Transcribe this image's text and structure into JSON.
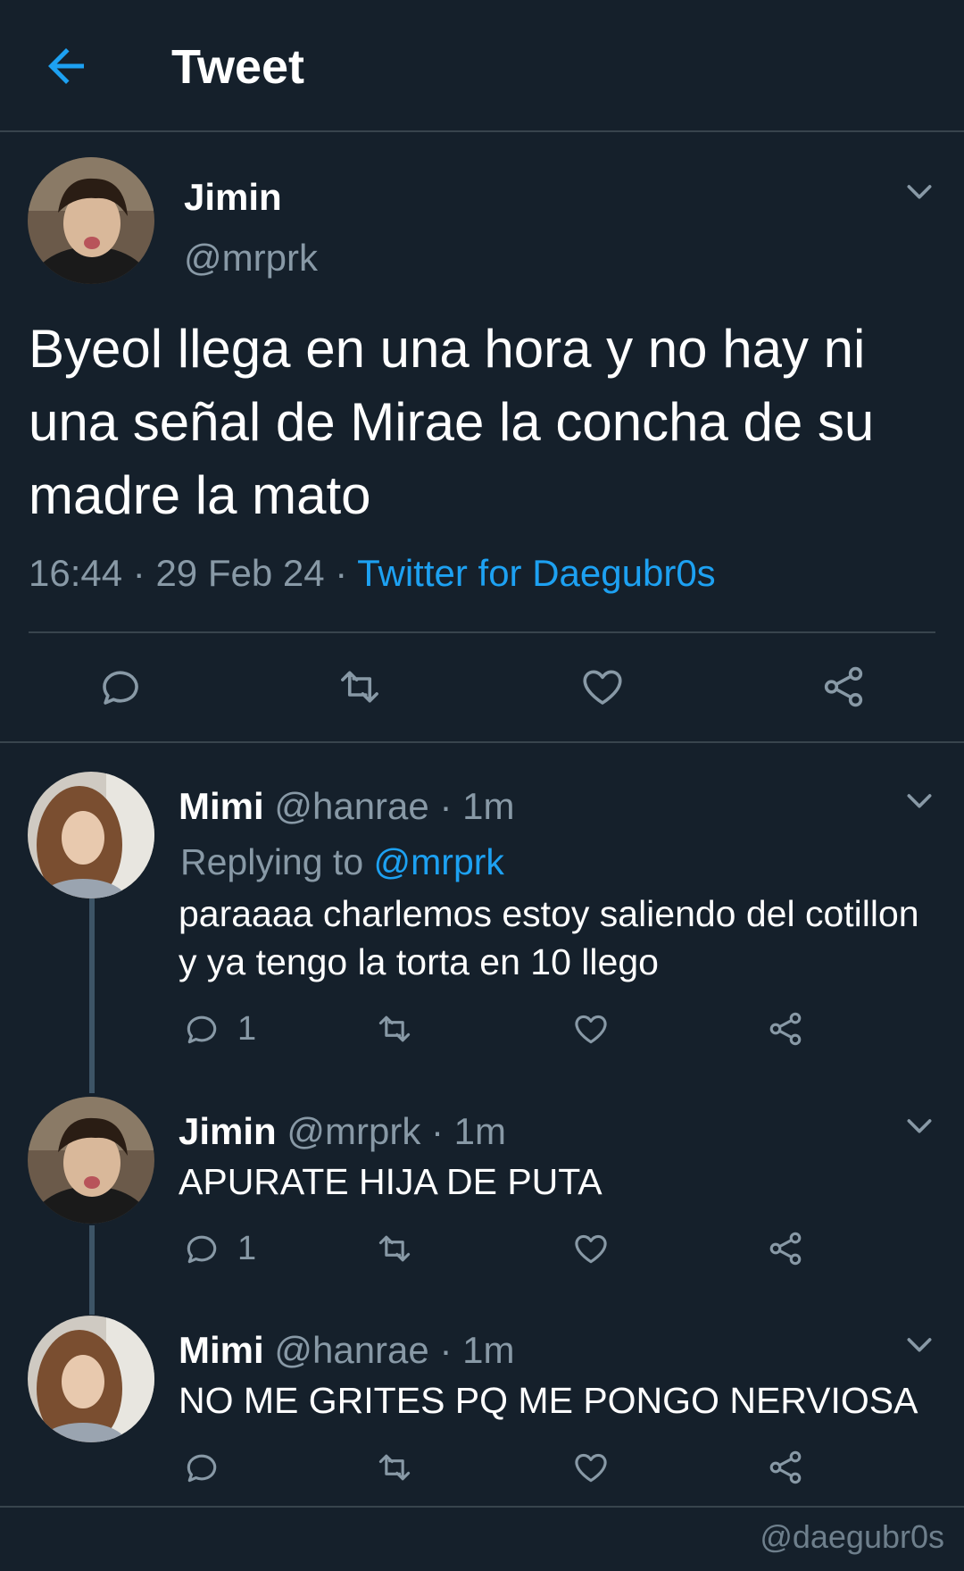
{
  "header": {
    "title": "Tweet"
  },
  "main_tweet": {
    "name": "Jimin",
    "handle": "@mrprk",
    "text": "Byeol llega en una hora y no hay ni una señal de Mirae la concha de su madre la mato",
    "time": "16:44",
    "sep1": " · ",
    "date": "29 Feb 24",
    "sep2": " · ",
    "source": "Twitter for Daegubr0s"
  },
  "replies": [
    {
      "name": "Mimi",
      "handle": "@hanrae",
      "time": "· 1m",
      "replying_label": "Replying to",
      "replying_to": "@mrprk",
      "text": "paraaaa charlemos estoy saliendo del cotillon y ya tengo la torta en 10 llego",
      "reply_count": "1"
    },
    {
      "name": "Jimin",
      "handle": "@mrprk",
      "time": "· 1m",
      "text": "APURATE HIJA DE PUTA",
      "reply_count": "1"
    },
    {
      "name": "Mimi",
      "handle": "@hanrae",
      "time": "· 1m",
      "text": "NO ME GRITES PQ ME PONGO NERVIOSA",
      "reply_count": ""
    }
  ],
  "watermark": "@daegubr0s",
  "colors": {
    "background": "#15202b",
    "accent": "#1da1f2",
    "muted": "#8899a6",
    "divider": "#38444d"
  },
  "icons": [
    "back-arrow-icon",
    "chevron-down-icon",
    "reply-icon",
    "retweet-icon",
    "like-icon",
    "share-icon"
  ]
}
